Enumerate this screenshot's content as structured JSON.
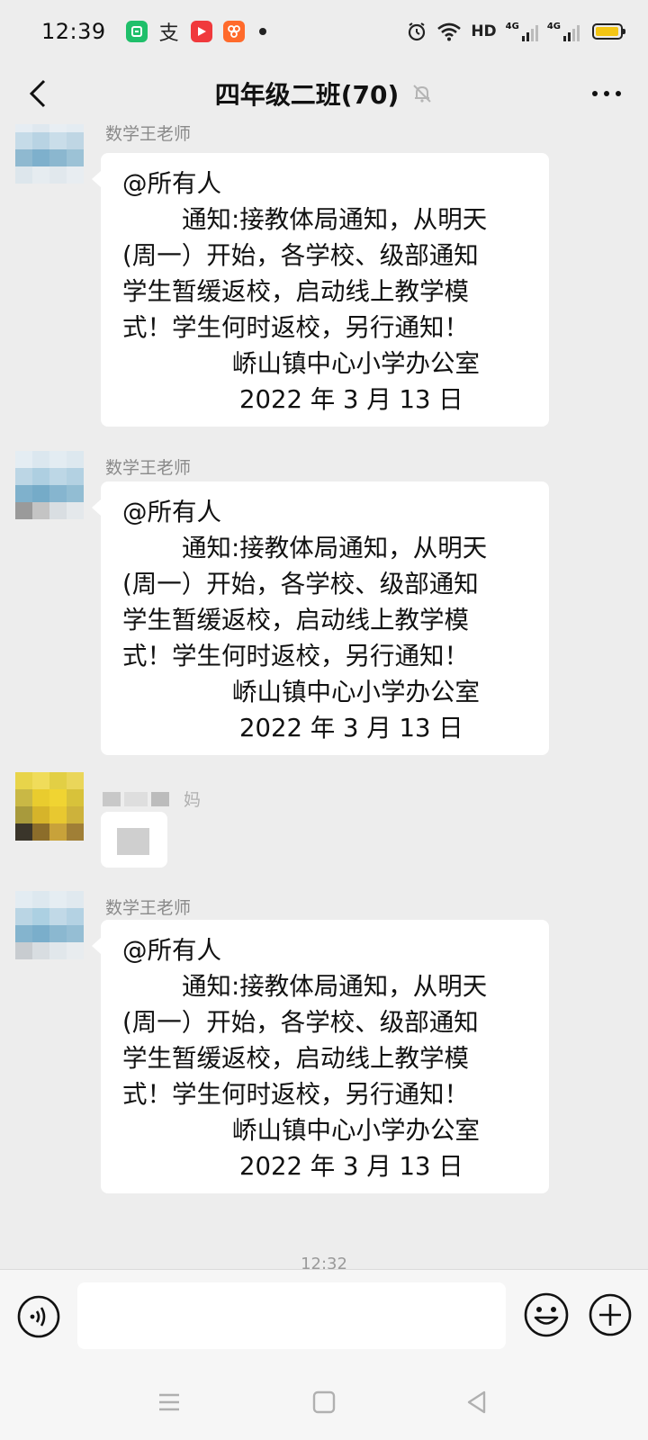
{
  "status_bar": {
    "time": "12:39",
    "apps": [
      "wechat-mini-icon",
      "alipay-icon",
      "video-app-icon",
      "photo-app-icon"
    ],
    "alipay_glyph": "支",
    "network_label": "HD",
    "signal_label_1": "4G",
    "signal_label_2": "4G",
    "battery_level": 0.95,
    "battery_color": "#f3c514"
  },
  "header": {
    "title": "四年级二班(70)",
    "muted": true
  },
  "messages": [
    {
      "sender": "数学王老师",
      "lines": [
        "@所有人",
        "通知:接教体局通知，从明天",
        "(周一）开始，各学校、级部通知",
        "学生暂缓返校，启动线上教学模",
        "式！学生何时返校，另行通知！",
        "峤山镇中心小学办公室",
        "2022 年 3 月 13 日"
      ]
    },
    {
      "sender": "数学王老师",
      "lines": [
        "@所有人",
        "通知:接教体局通知，从明天",
        "(周一）开始，各学校、级部通知",
        "学生暂缓返校，启动线上教学模",
        "式！学生何时返校，另行通知！",
        "峤山镇中心小学办公室",
        "2022 年 3 月 13 日"
      ]
    },
    {
      "sender_partial": "妈"
    },
    {
      "sender": "数学王老师",
      "lines": [
        "@所有人",
        "通知:接教体局通知，从明天",
        "(周一）开始，各学校、级部通知",
        "学生暂缓返校，启动线上教学模",
        "式！学生何时返校，另行通知！",
        "峤山镇中心小学办公室",
        "2022 年 3 月 13 日"
      ]
    }
  ],
  "time_divider": "12:32",
  "input": {
    "value": "",
    "placeholder": ""
  }
}
